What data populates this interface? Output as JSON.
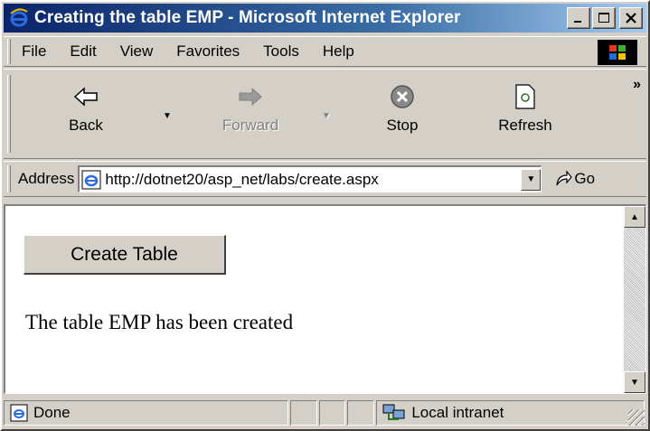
{
  "window": {
    "title": "Creating the table EMP - Microsoft Internet Explorer"
  },
  "menu": {
    "items": [
      {
        "label": "File"
      },
      {
        "label": "Edit"
      },
      {
        "label": "View"
      },
      {
        "label": "Favorites"
      },
      {
        "label": "Tools"
      },
      {
        "label": "Help"
      }
    ]
  },
  "toolbar": {
    "back": "Back",
    "forward": "Forward",
    "stop": "Stop",
    "refresh": "Refresh"
  },
  "address": {
    "label": "Address",
    "url": "http://dotnet20/asp_net/labs/create.aspx",
    "go": "Go"
  },
  "page": {
    "button": "Create Table",
    "message": "The table EMP has been created"
  },
  "status": {
    "text": "Done",
    "zone": "Local intranet"
  },
  "colors": {
    "titlebar_start": "#0a246a",
    "titlebar_end": "#a6caf0",
    "chrome": "#d4d0c8"
  }
}
